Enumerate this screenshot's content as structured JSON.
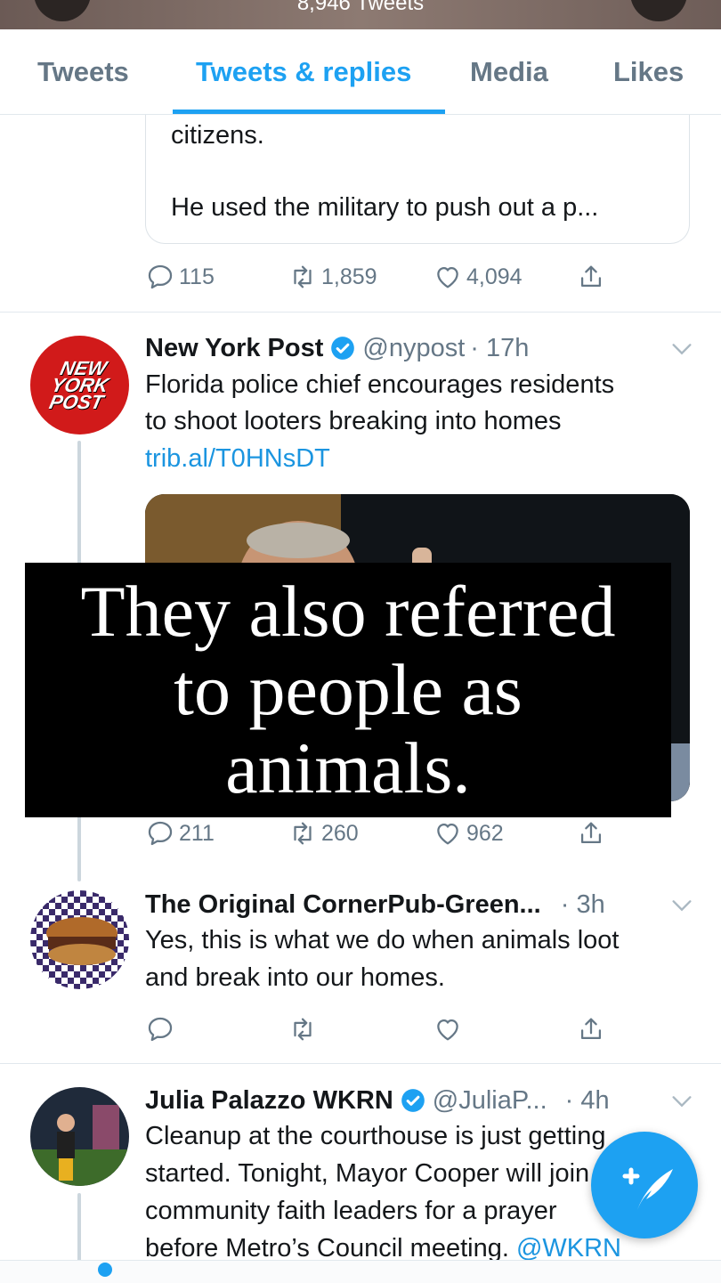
{
  "header": {
    "tweet_count": "8,946 Tweets"
  },
  "tabs": [
    {
      "label": "Tweets"
    },
    {
      "label": "Tweets & replies"
    },
    {
      "label": "Media"
    },
    {
      "label": "Likes"
    }
  ],
  "active_tab": "Tweets & replies",
  "quoted_fragment": {
    "line1": "citizens.",
    "line2": "He used the military to push out a p..."
  },
  "tweet0_actions": {
    "replies": "115",
    "retweets": "1,859",
    "likes": "4,094"
  },
  "tweet1": {
    "name": "New York Post",
    "handle": "@nypost",
    "time": "· 17h",
    "avatar_text": [
      "NEW",
      "YORK",
      "POST"
    ],
    "lines": [
      "Florida police chief encourages residents",
      "to shoot looters breaking into homes"
    ],
    "link": "trib.al/T0HNsDT",
    "actions": {
      "replies": "211",
      "retweets": "260",
      "likes": "962"
    }
  },
  "overlay_caption": [
    "They also referred",
    "to people as",
    "animals."
  ],
  "tweet2": {
    "name": "The Original CornerPub-Green...",
    "time": "· 3h",
    "lines": [
      "Yes, this is what we do when animals loot",
      "and break into our homes."
    ]
  },
  "tweet3": {
    "name": "Julia Palazzo WKRN",
    "handle": "@JuliaP...",
    "time": "· 4h",
    "lines": [
      "Cleanup at the courthouse is just getting",
      "started. Tonight, Mayor Cooper will join",
      "community faith leaders for a prayer",
      "before Metro’s Council meeting."
    ],
    "mention": "@WKRN"
  },
  "colors": {
    "accent": "#1da1f2",
    "secondary_text": "#657786",
    "nypost_red": "#d11a1a"
  },
  "icons": {
    "reply": "reply-icon",
    "retweet": "retweet-icon",
    "like": "heart-icon",
    "share": "share-icon",
    "verified": "verified-badge-icon",
    "caret": "chevron-down-icon",
    "compose": "compose-tweet-icon"
  }
}
